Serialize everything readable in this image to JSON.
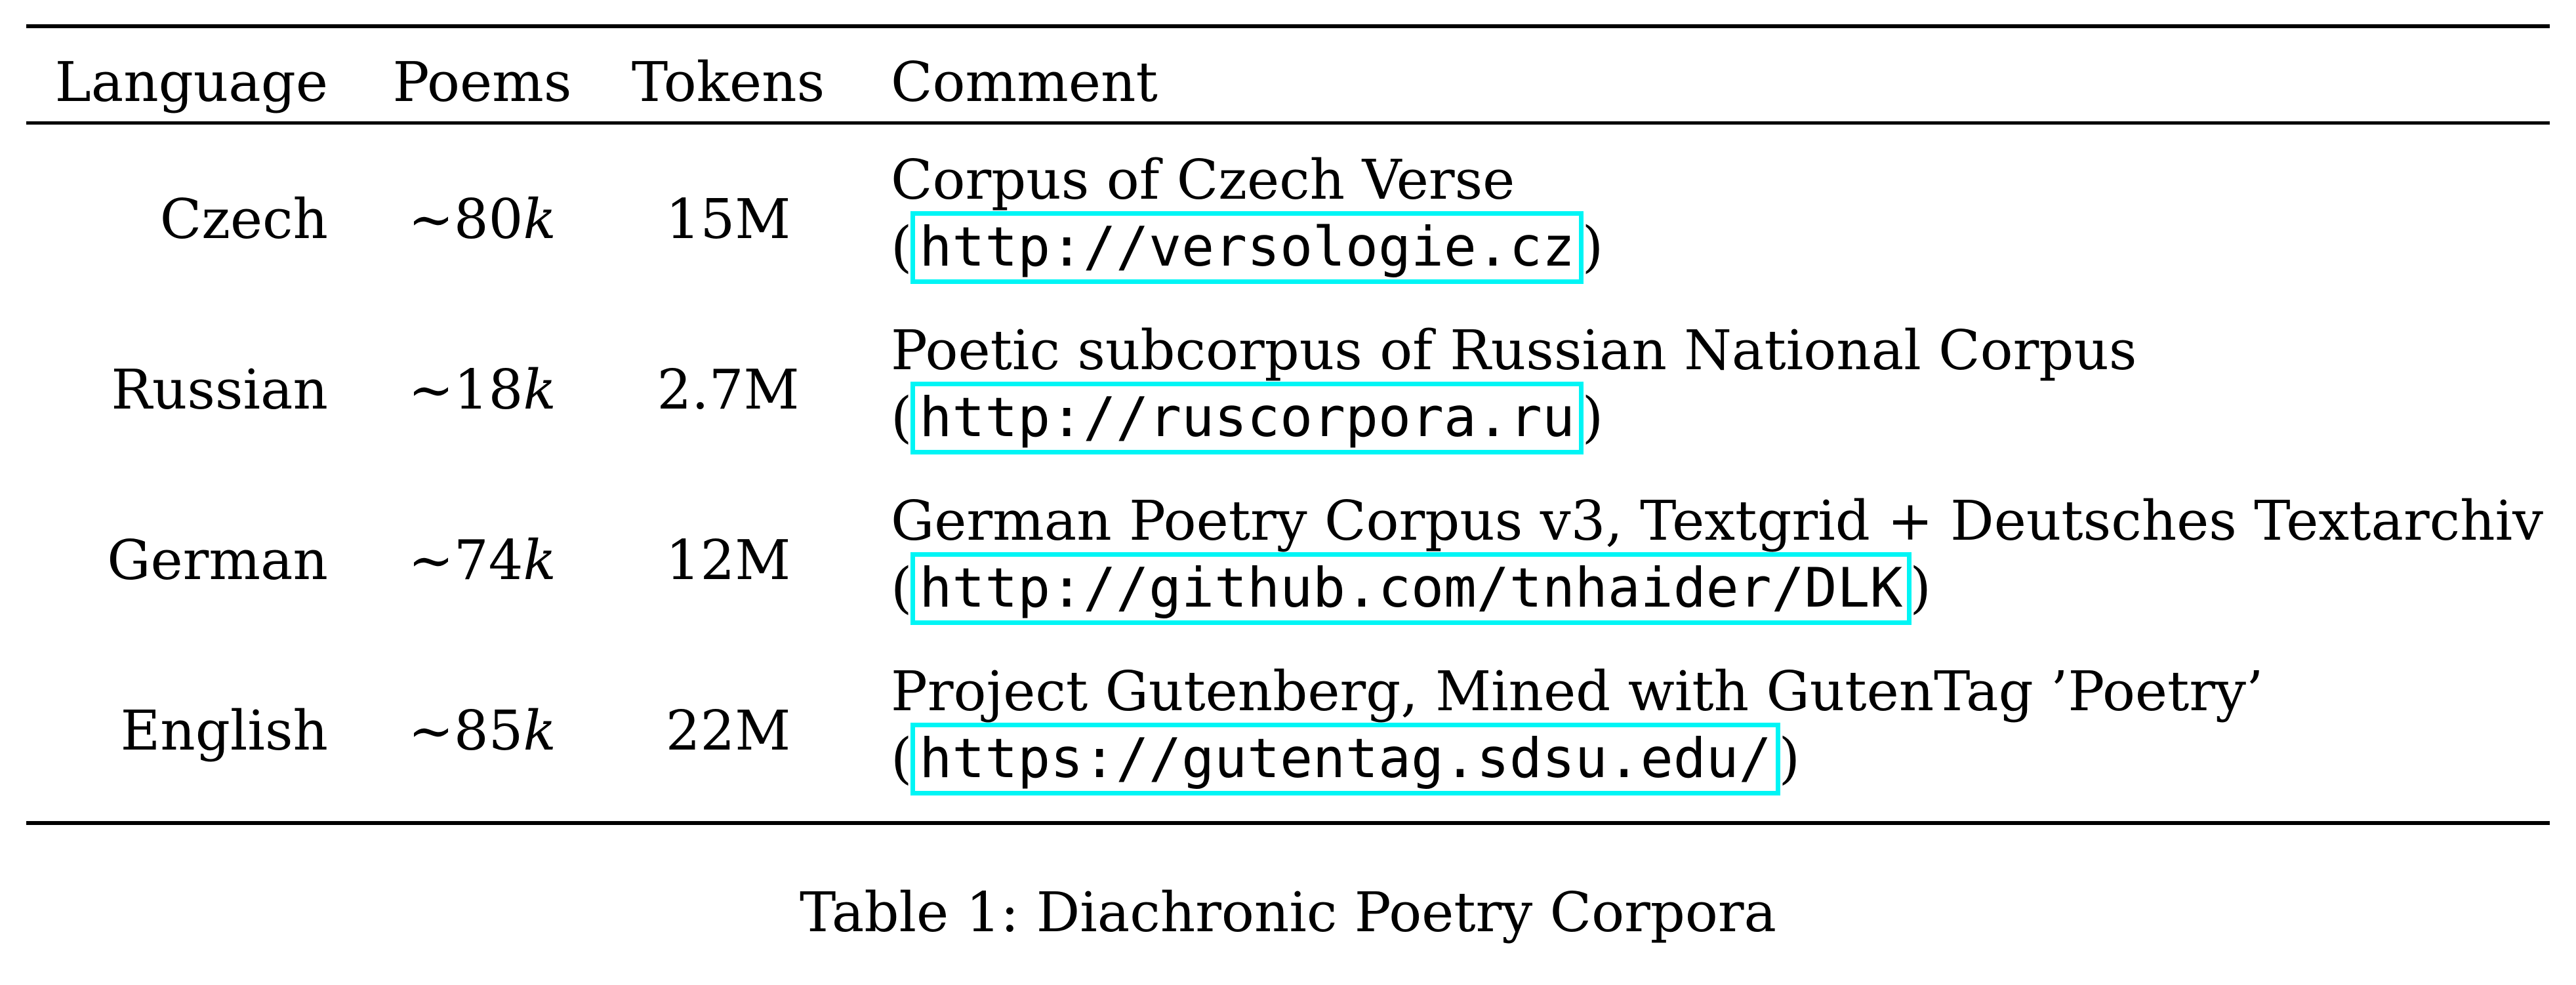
{
  "table": {
    "headers": {
      "language": "Language",
      "poems": "Poems",
      "tokens": "Tokens",
      "comment": "Comment"
    },
    "rows": [
      {
        "language": "Czech",
        "poems_tilde": "∼",
        "poems_num": "80",
        "poems_unit": "k",
        "tokens": "15M",
        "comment_text": "Corpus of Czech Verse",
        "open_paren": "(",
        "url": "http://versologie.cz",
        "close_paren": ")"
      },
      {
        "language": "Russian",
        "poems_tilde": "∼",
        "poems_num": "18",
        "poems_unit": "k",
        "tokens": "2.7M",
        "comment_text": "Poetic subcorpus of Russian National Corpus",
        "open_paren": "(",
        "url": "http://ruscorpora.ru",
        "close_paren": ")"
      },
      {
        "language": "German",
        "poems_tilde": "∼",
        "poems_num": "74",
        "poems_unit": "k",
        "tokens": "12M",
        "comment_text": "German Poetry Corpus v3, Textgrid + Deutsches Textarchiv",
        "open_paren": "(",
        "url": "http://github.com/tnhaider/DLK",
        "close_paren": ")"
      },
      {
        "language": "English",
        "poems_tilde": "∼",
        "poems_num": "85",
        "poems_unit": "k",
        "tokens": "22M",
        "comment_text": "Project Gutenberg, Mined with GutenTag ’Poetry’",
        "open_paren": "(",
        "url": "https://gutentag.sdsu.edu/",
        "close_paren": ")"
      }
    ]
  },
  "caption": "Table 1: Diachronic Poetry Corpora",
  "colors": {
    "link_box": "#00f5f5",
    "rule": "#000000"
  }
}
